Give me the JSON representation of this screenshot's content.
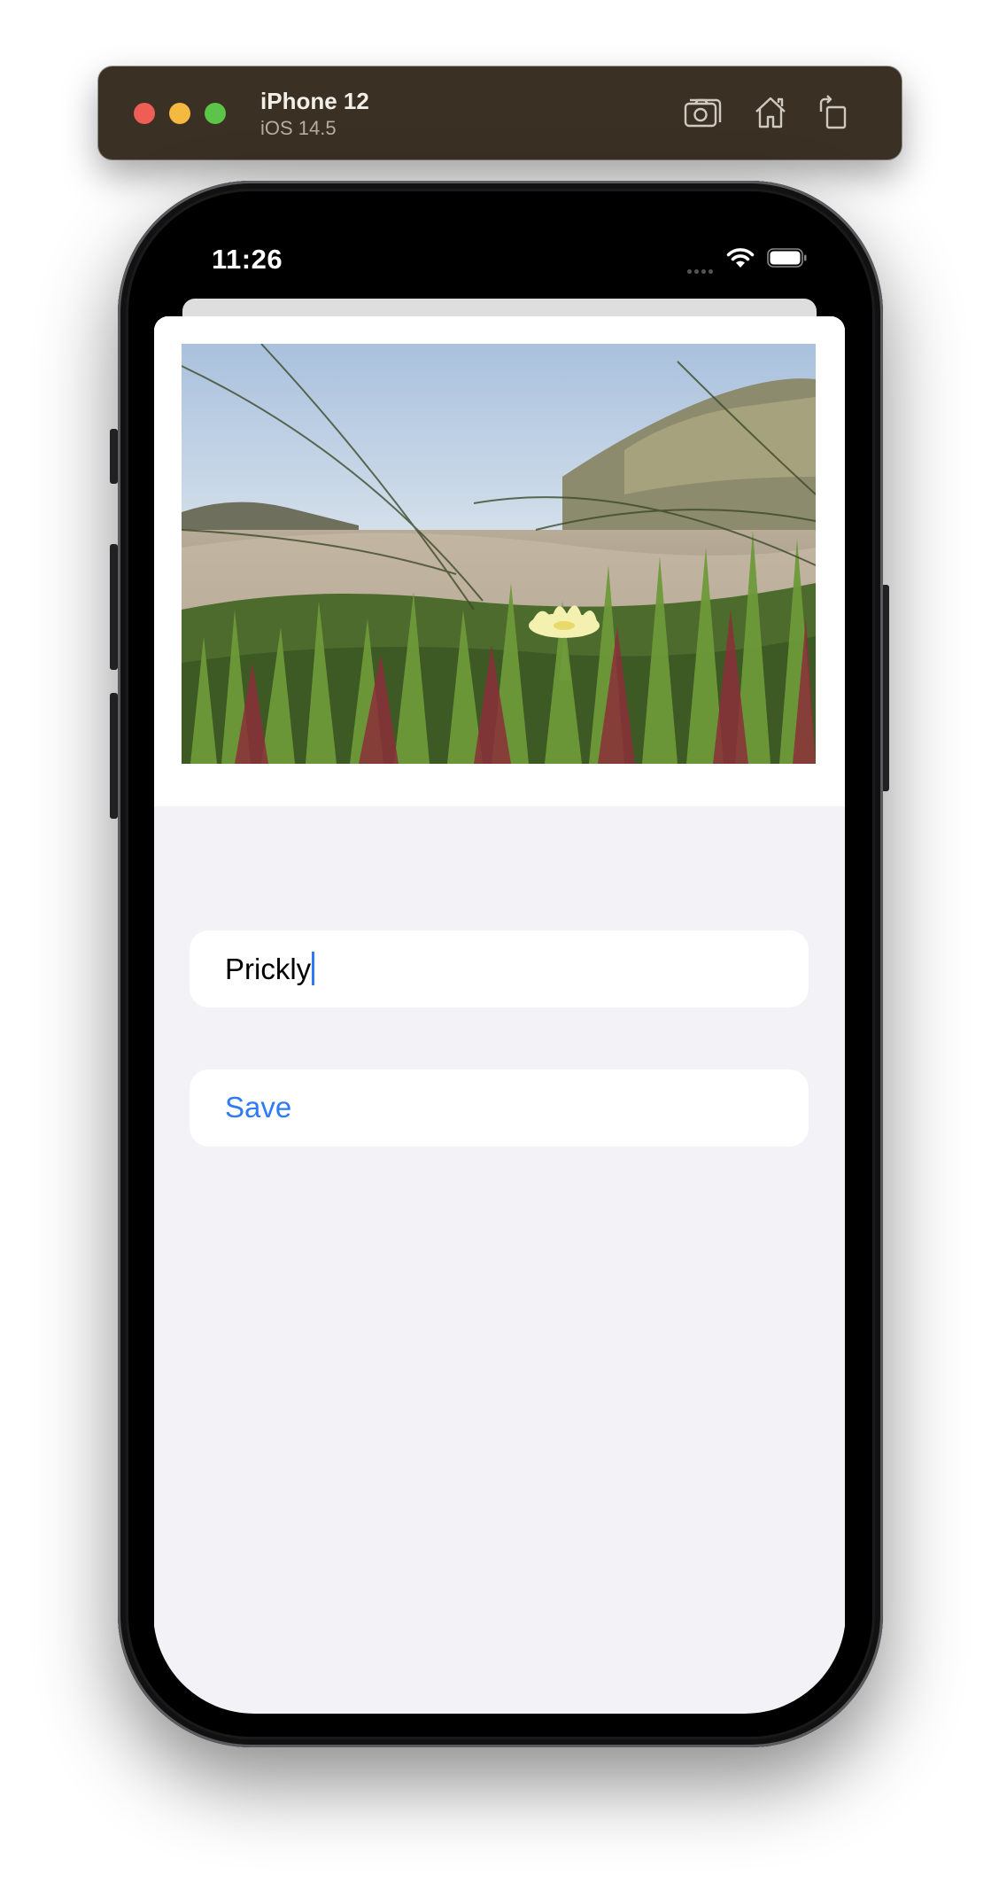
{
  "window": {
    "device_name": "iPhone 12",
    "os_version": "iOS 14.5",
    "buttons": {
      "screenshot_icon": "camera-icon",
      "home_icon": "home-icon",
      "rotate_icon": "rotate-icon"
    }
  },
  "status_bar": {
    "time": "11:26"
  },
  "form": {
    "name_value": "Prickly",
    "save_label": "Save"
  },
  "colors": {
    "accent": "#2f7bf6",
    "background": "#f2f2f7",
    "toolbar": "#3a3024"
  }
}
